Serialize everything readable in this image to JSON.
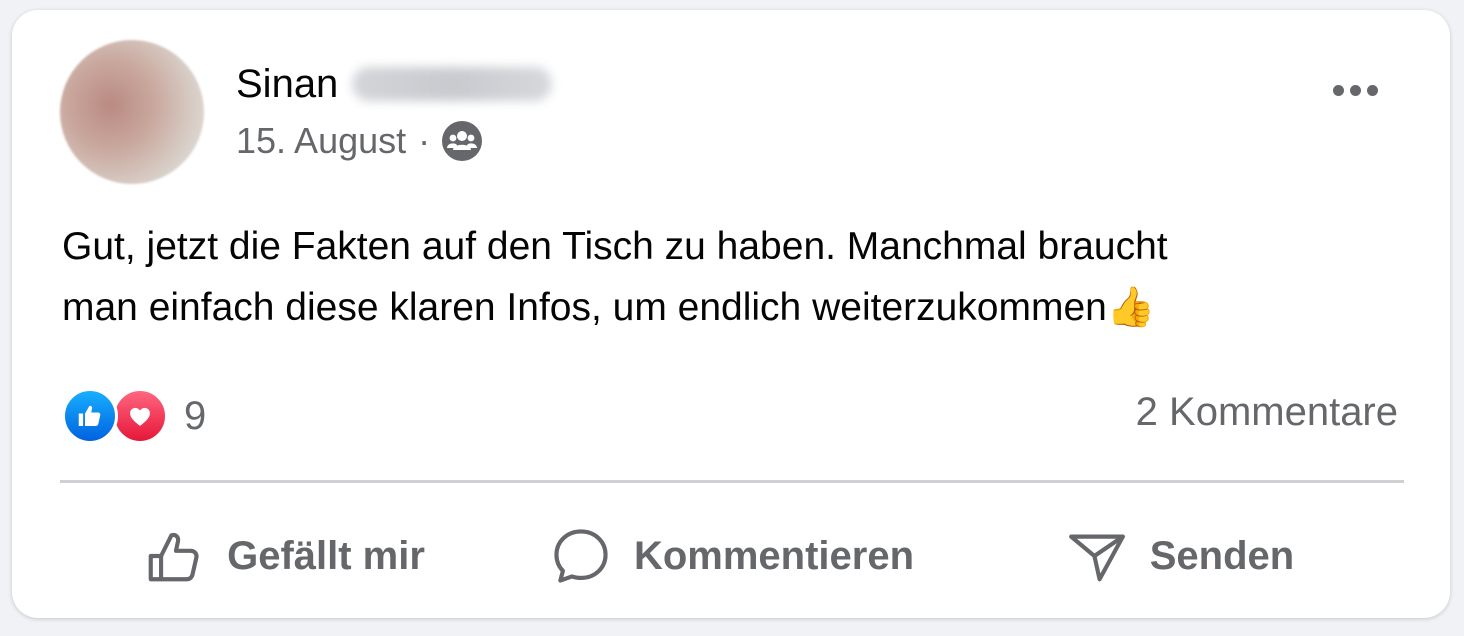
{
  "post": {
    "author_first": "Sinan",
    "date": "15. August",
    "separator": "·",
    "audience_icon": "friends-icon",
    "text_line1": "Gut, jetzt die Fakten auf den Tisch zu haben. Manchmal braucht",
    "text_line2": "man einfach diese klaren Infos, um endlich weiterzukommen👍",
    "more_icon": "more-dots-icon"
  },
  "stats": {
    "reaction_icons": [
      "like-reaction-icon",
      "love-reaction-icon"
    ],
    "reaction_count": "9",
    "comments": "2 Kommentare"
  },
  "actions": [
    {
      "label": "Gefällt mir",
      "icon": "thumbs-up-icon"
    },
    {
      "label": "Kommentieren",
      "icon": "comment-bubble-icon"
    },
    {
      "label": "Senden",
      "icon": "send-icon"
    }
  ],
  "colors": {
    "text": "#050505",
    "secondary": "#65676b",
    "like_blue": "#0866ff",
    "love_red": "#f33e58",
    "divider": "#ced0d4"
  }
}
